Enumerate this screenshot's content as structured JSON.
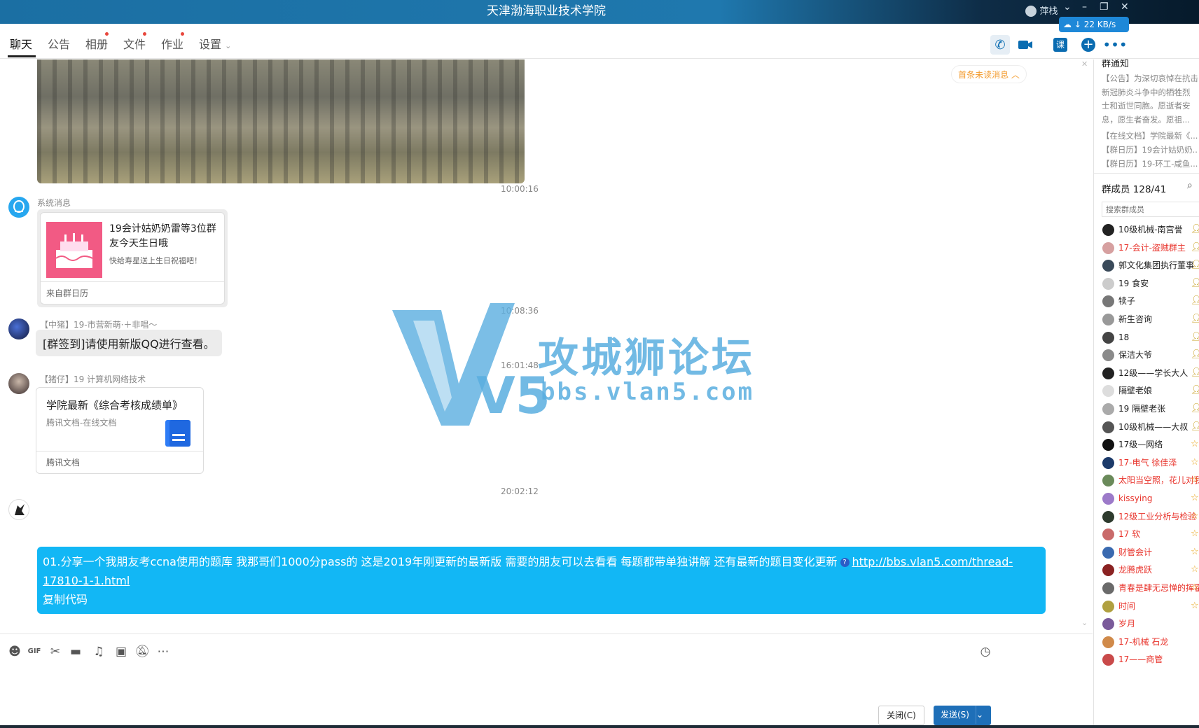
{
  "window": {
    "title": "天津渤海职业技术学院",
    "user_label": "萍栈",
    "network_speed": "22 KB/s"
  },
  "tabs": [
    {
      "label": "聊天",
      "active": true,
      "dot": false
    },
    {
      "label": "公告",
      "active": false,
      "dot": false
    },
    {
      "label": "相册",
      "active": false,
      "dot": true
    },
    {
      "label": "文件",
      "active": false,
      "dot": true
    },
    {
      "label": "作业",
      "active": false,
      "dot": true
    },
    {
      "label": "设置",
      "active": false,
      "dot": false
    }
  ],
  "toolbar": {
    "course_label": "课"
  },
  "chat": {
    "unread_tip": "首条未读消息",
    "messages": [
      {
        "time": "10:00:16",
        "sender": "系统消息",
        "card": {
          "title": "19会计姑奶奶雷等3位群友今天生日哦",
          "subtitle": "快给寿星送上生日祝福吧！",
          "footer": "来自群日历"
        }
      },
      {
        "time": "10:08:36",
        "sender": "【中猪】19-市营新萌·＋非唱～",
        "text": "[群签到]请使用新版QQ进行查看。"
      },
      {
        "time": "16:01:48",
        "sender": "【猪仔】19  计算机网络技术",
        "doc": {
          "title": "学院最新《综合考核成绩单》",
          "subtitle": "腾讯文档-在线文档",
          "footer": "腾讯文档"
        }
      },
      {
        "time": "20:02:12",
        "text": "01.分享一个我朋友考ccna使用的题库 我那哥们1000分pass的 这是2019年刚更新的最新版 需要的朋友可以去看看 每题都带单独讲解 还有最新的题目变化更新",
        "link": "http://bbs.vlan5.com/thread-17810-1-1.html",
        "copy_label": "复制代码"
      }
    ]
  },
  "watermark": {
    "logo": "V5",
    "title": "攻城狮论坛",
    "url": "bbs.vlan5.com"
  },
  "input": {
    "close_label": "关闭(C)",
    "send_label": "发送(S)"
  },
  "sidebar": {
    "notice_title": "群通知",
    "notice_lines": [
      "【公告】为深切哀悼在抗击",
      "新冠肺炎斗争中的牺牲烈",
      "士和逝世同胞。愿逝者安",
      "息，愿生者奋发。愿祖..."
    ],
    "notice_items": [
      "【在线文档】学院最新《...",
      "【群日历】19会计姑奶奶...",
      "【群日历】19-环工-咸鱼..."
    ],
    "members_title": "群成员 128/41",
    "member_search_placeholder": "搜索群成员",
    "members": [
      {
        "name": "10级机械-南宫誉",
        "color": "#222222",
        "badge": "person-icon"
      },
      {
        "name": "17-会计-盗贼群主",
        "color": "#e8332b",
        "badge": "person-icon"
      },
      {
        "name": "郭文化集团执行董事",
        "color": "#222222",
        "badge": "person-icon"
      },
      {
        "name": "19  食安",
        "color": "#222222",
        "badge": "person-icon"
      },
      {
        "name": "犊子",
        "color": "#222222",
        "badge": "person-icon"
      },
      {
        "name": "新生咨询",
        "color": "#222222",
        "badge": "person-icon"
      },
      {
        "name": "18",
        "color": "#222222",
        "badge": "person-icon"
      },
      {
        "name": "保洁大爷",
        "color": "#222222",
        "badge": "person-icon"
      },
      {
        "name": "12级——学长大人",
        "color": "#222222",
        "badge": "person-icon"
      },
      {
        "name": "隔壁老娘",
        "color": "#222222",
        "badge": "person-icon"
      },
      {
        "name": "19 隔壁老张",
        "color": "#222222",
        "badge": "person-icon"
      },
      {
        "name": "10级机械——大叔",
        "color": "#222222",
        "badge": "person-icon"
      },
      {
        "name": "17级—网络",
        "color": "#222222",
        "badge": "star-icon"
      },
      {
        "name": "17-电气 徐佳泽",
        "color": "#e8332b",
        "badge": "star-icon"
      },
      {
        "name": "太阳当空照，花儿对我笑",
        "color": "#e8332b",
        "badge": "star-icon"
      },
      {
        "name": "kissying",
        "color": "#e8332b",
        "badge": "star-icon"
      },
      {
        "name": "12级工业分析与检验",
        "color": "#e8332b",
        "badge": "star-icon"
      },
      {
        "name": "17  软",
        "color": "#e8332b",
        "badge": "star-icon"
      },
      {
        "name": "财管会计",
        "color": "#e8332b",
        "badge": "star-icon"
      },
      {
        "name": "龙腾虎跃",
        "color": "#e8332b",
        "badge": "star-icon"
      },
      {
        "name": "青春是肆无忌惮的挥霍",
        "color": "#e8332b",
        "badge": "star-icon"
      },
      {
        "name": "时间",
        "color": "#e8332b",
        "badge": "star-icon"
      },
      {
        "name": "岁月",
        "color": "#e8332b",
        "badge": ""
      },
      {
        "name": "17-机械 石龙",
        "color": "#e8332b",
        "badge": ""
      },
      {
        "name": "17——商管",
        "color": "#e8332b",
        "badge": ""
      }
    ]
  },
  "colors": {
    "accent": "#12b7f5",
    "brand": "#1f78ae",
    "send_button": "#1e6fb8",
    "owner_red": "#e8332b",
    "watermark": "#5aaee0"
  }
}
